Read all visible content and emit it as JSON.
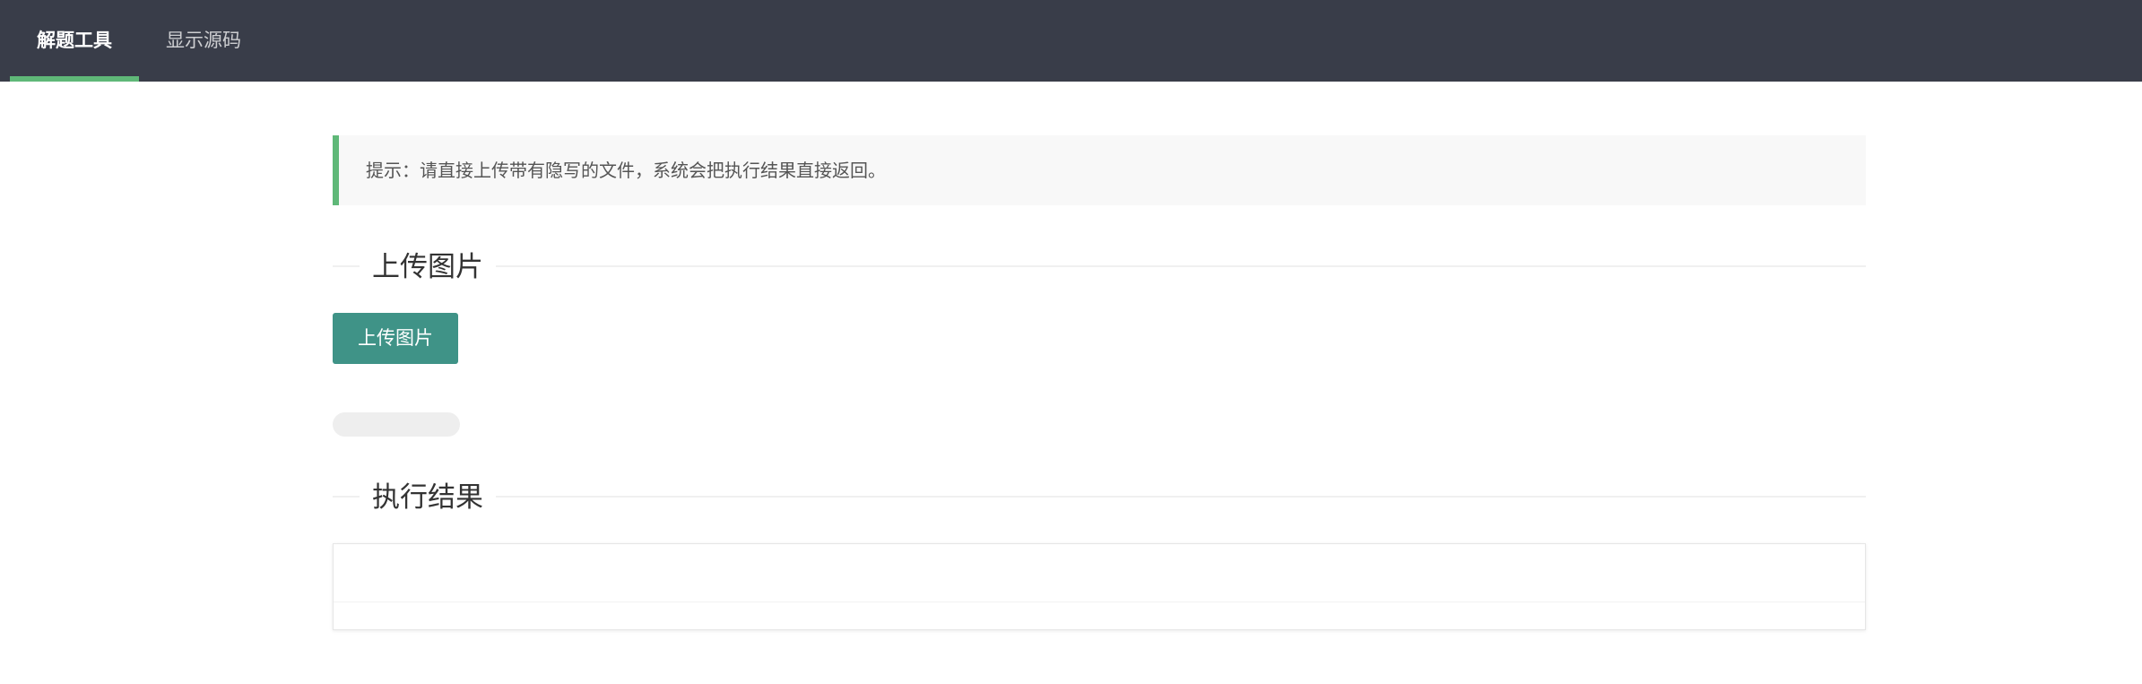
{
  "nav": {
    "tabs": [
      {
        "label": "解题工具",
        "active": true
      },
      {
        "label": "显示源码",
        "active": false
      }
    ],
    "accent_color": "#5fb878",
    "background_color": "#393d49"
  },
  "tip": {
    "text": "提示：请直接上传带有隐写的文件，系统会把执行结果直接返回。"
  },
  "upload_section": {
    "title": "上传图片",
    "button_label": "上传图片",
    "button_color": "#3f9387",
    "progress_percent": 0
  },
  "result_section": {
    "title": "执行结果",
    "content": ""
  }
}
